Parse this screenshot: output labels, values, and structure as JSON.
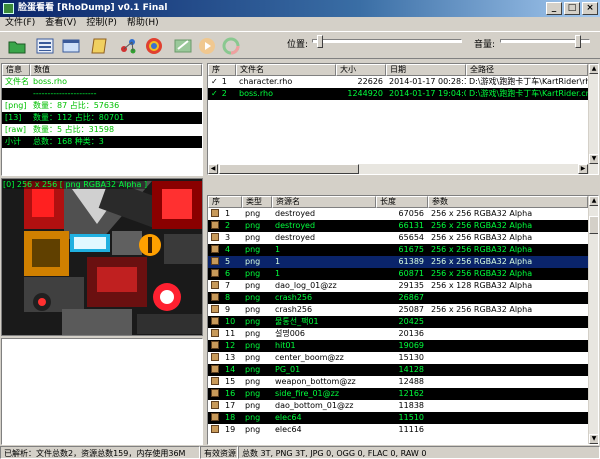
{
  "window": {
    "title": "脸蛋看看 [RhoDump] v0.1 Final"
  },
  "menu": [
    "文件(F)",
    "查看(V)",
    "控制(P)",
    "帮助(H)"
  ],
  "toolbar": {
    "position_label": "位置:",
    "volume_label": "音量:",
    "position_value": 0.03,
    "volume_value": 0.88
  },
  "info": {
    "headers": [
      "信息",
      "数值"
    ],
    "rows": [
      {
        "label": "文件名",
        "value": "boss.rho",
        "black": false
      },
      {
        "label": "",
        "value": "----------------------",
        "black": true
      },
      {
        "label": "[png]",
        "value": "数量：87     占比：57636",
        "black": false
      },
      {
        "label": "[13]",
        "value": "数量：112     占比：80701",
        "black": true
      },
      {
        "label": "[raw]",
        "value": "数量：5     占比：31598",
        "black": false
      },
      {
        "label": "小计",
        "value": "总数：168     种类：3",
        "black": true
      }
    ]
  },
  "preview_caption": "[0] 256 x 256  [ png RGBA32 Alpha ]",
  "files": {
    "headers": [
      "序",
      "文件名",
      "大小",
      "日期",
      "全路径"
    ],
    "rows": [
      {
        "check": "✓",
        "idx": "1",
        "name": "character.rho",
        "size": "22626",
        "date": "2014-01-17 00:28:10",
        "path": "D:\\游戏\\跑跑卡丁车\\KartRider\\rho\\Data\\character.rho",
        "black": false
      },
      {
        "check": "✓",
        "idx": "2",
        "name": "boss.rho",
        "size": "1244920",
        "date": "2014-01-17 19:04:08",
        "path": "D:\\游戏\\跑跑卡丁车\\KartRider.cn\\Data\\boss.rho",
        "black": true
      }
    ]
  },
  "resources": {
    "headers": [
      "序",
      "类型",
      "资源名",
      "长度",
      "参数"
    ],
    "rows": [
      {
        "idx": "1",
        "type": "png",
        "name": "destroyed",
        "len": "67056",
        "param": "256 x 256  RGBA32 Alpha",
        "style": "white"
      },
      {
        "idx": "2",
        "type": "png",
        "name": "destroyed",
        "len": "66131",
        "param": "256 x 256  RGBA32 Alpha",
        "style": "black"
      },
      {
        "idx": "3",
        "type": "png",
        "name": "destroyed",
        "len": "65654",
        "param": "256 x 256  RGBA32 Alpha",
        "style": "white"
      },
      {
        "idx": "4",
        "type": "png",
        "name": "1",
        "len": "61675",
        "param": "256 x 256  RGBA32 Alpha",
        "style": "black"
      },
      {
        "idx": "5",
        "type": "png",
        "name": "1",
        "len": "61389",
        "param": "256 x 256  RGBA32 Alpha",
        "style": "sel"
      },
      {
        "idx": "6",
        "type": "png",
        "name": "1",
        "len": "60871",
        "param": "256 x 256  RGBA32 Alpha",
        "style": "black"
      },
      {
        "idx": "7",
        "type": "png",
        "name": "dao_log_01@zz",
        "len": "29135",
        "param": "256 x 128  RGBA32 Alpha",
        "style": "white"
      },
      {
        "idx": "8",
        "type": "png",
        "name": "crash256",
        "len": "26867",
        "param": "",
        "style": "black"
      },
      {
        "idx": "9",
        "type": "png",
        "name": "crash256",
        "len": "25087",
        "param": "256 x 256  RGBA32 Alpha",
        "style": "white"
      },
      {
        "idx": "10",
        "type": "png",
        "name": "물통선_팩01",
        "len": "20425",
        "param": "",
        "style": "black"
      },
      {
        "idx": "11",
        "type": "png",
        "name": "설명006",
        "len": "20136",
        "param": "",
        "style": "white"
      },
      {
        "idx": "12",
        "type": "png",
        "name": "hit01",
        "len": "19069",
        "param": "",
        "style": "black"
      },
      {
        "idx": "13",
        "type": "png",
        "name": "center_boom@zz",
        "len": "15130",
        "param": "",
        "style": "white"
      },
      {
        "idx": "14",
        "type": "png",
        "name": "PG_01",
        "len": "14128",
        "param": "",
        "style": "black"
      },
      {
        "idx": "15",
        "type": "png",
        "name": "weapon_bottom@zz",
        "len": "12488",
        "param": "",
        "style": "white"
      },
      {
        "idx": "16",
        "type": "png",
        "name": "side_fire_01@zz",
        "len": "12162",
        "param": "",
        "style": "black"
      },
      {
        "idx": "17",
        "type": "png",
        "name": "dao_bottom_01@zz",
        "len": "11838",
        "param": "",
        "style": "white"
      },
      {
        "idx": "18",
        "type": "png",
        "name": "elec64",
        "len": "11510",
        "param": "",
        "style": "black"
      },
      {
        "idx": "19",
        "type": "png",
        "name": "elec64",
        "len": "11116",
        "param": "",
        "style": "white"
      }
    ]
  },
  "status": {
    "left": "已解析：文件总数2，资源总数159，内存使用36M",
    "mid": "有效资源",
    "right": "总数 3T, PNG 3T, JPG 0, OGG 0, FLAC 0, RAW 0"
  }
}
